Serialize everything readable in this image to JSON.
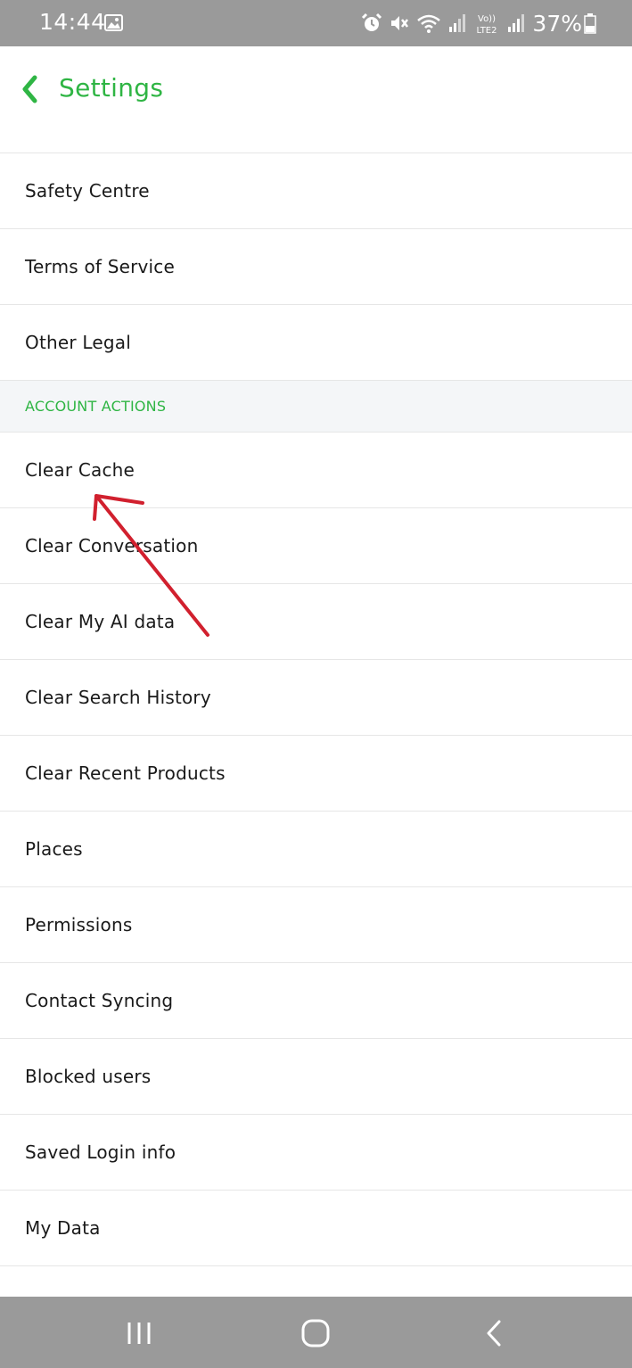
{
  "status_bar": {
    "time": "14:44",
    "battery": "37%",
    "icons": [
      "gallery-icon",
      "alarm-icon",
      "mute-icon",
      "wifi-icon",
      "signal-icon",
      "volte-lte2-icon",
      "signal-icon",
      "battery-icon"
    ],
    "volte_top": "Vo))",
    "volte_bottom": "LTE2"
  },
  "header": {
    "title": "Settings",
    "back_icon": "chevron-left-icon"
  },
  "list": {
    "rows_before_section": [
      {
        "label": "Safety Centre"
      },
      {
        "label": "Terms of Service"
      },
      {
        "label": "Other Legal"
      }
    ],
    "section_header": "ACCOUNT ACTIONS",
    "rows_after_section": [
      {
        "label": "Clear Cache"
      },
      {
        "label": "Clear Conversation"
      },
      {
        "label": "Clear My AI data"
      },
      {
        "label": "Clear Search History"
      },
      {
        "label": "Clear Recent Products"
      },
      {
        "label": "Places"
      },
      {
        "label": "Permissions"
      },
      {
        "label": "Contact Syncing"
      },
      {
        "label": "Blocked users"
      },
      {
        "label": "Saved Login info"
      },
      {
        "label": "My Data"
      }
    ]
  },
  "annotation": {
    "arrow_color": "#d1202e"
  },
  "nav_bar": {
    "buttons": [
      "recents-icon",
      "home-icon",
      "back-icon"
    ]
  },
  "colors": {
    "accent": "#2fb544",
    "status_bar": "#9a9a9a",
    "section_bg": "#f4f6f8",
    "divider": "#e6e6e6",
    "text": "#1a1a1a"
  }
}
